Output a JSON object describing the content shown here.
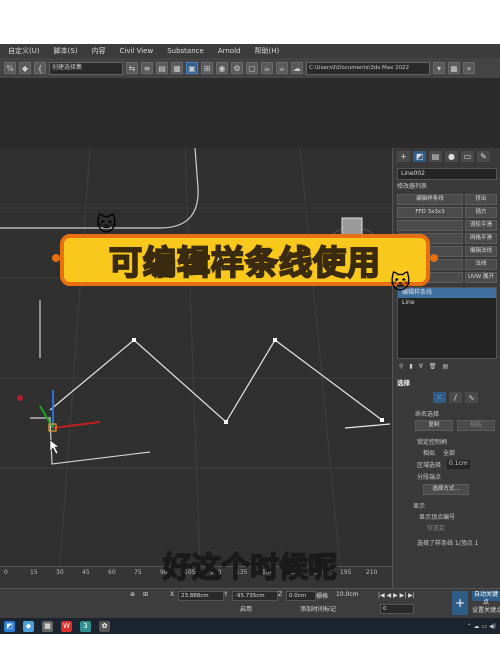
{
  "menu": [
    "自定义(U)",
    "脚本(S)",
    "内容",
    "Civil View",
    "Substance",
    "Arnold",
    "帮助(H)"
  ],
  "toolbar": {
    "selection_set": "创建选择集",
    "path": "C:\\Users\\l\\Documents\\3ds Max 2022"
  },
  "command_panel": {
    "object_name": "Line002",
    "modifier_list_label": "修改器列表",
    "modifier_buttons": [
      [
        "编辑样条线",
        "挤出"
      ],
      [
        "FFD 3x3x3",
        "插方"
      ],
      [
        "",
        "涡轮平滑"
      ],
      [
        "",
        "网格平滑"
      ],
      [
        "",
        "编辑法线"
      ],
      [
        "",
        "法线"
      ],
      [
        "",
        "UVW 展开"
      ]
    ],
    "stack": [
      "编辑样条线",
      "Line"
    ],
    "selection_rollout": {
      "title": "选择",
      "named_selection": "命名选择",
      "copy": "复制",
      "paste": "粘贴",
      "lock_handles": "锁定控制柄",
      "similar": "相似",
      "all": "全部",
      "area_selection": "区域选择",
      "area_value": "0.1cm",
      "segment_end": "分段端点",
      "select_by": "选择方式...",
      "display": "显示",
      "show_vertex_numbers": "显示顶点编号",
      "only_selected": "仅选定",
      "selected_status": "选择了样条线 1/顶点 1"
    }
  },
  "timeline": {
    "ticks": [
      "0",
      "15",
      "30",
      "45",
      "60",
      "75",
      "90",
      "105",
      "120",
      "135",
      "150",
      "165",
      "180",
      "195",
      "210"
    ]
  },
  "status_bar": {
    "x_value": "23.888cm",
    "y_value": "-95.735cm",
    "z_value": "0.0cm",
    "grid_label": "栅格",
    "grid_value": "10.0cm",
    "enable": "启用",
    "add_time_tag": "添加时间标记",
    "frame_value": "0",
    "auto_key": "自动关键点",
    "set_key": "设置关键点"
  },
  "overlay": {
    "banner_title": "可编辑样条线使用",
    "subtitle": "好这个时候呢"
  },
  "colors": {
    "banner_fill": "#f8c81d",
    "banner_border": "#e86f12",
    "subtitle_text": "#f6e14b",
    "accent_blue": "#2d5d88"
  }
}
